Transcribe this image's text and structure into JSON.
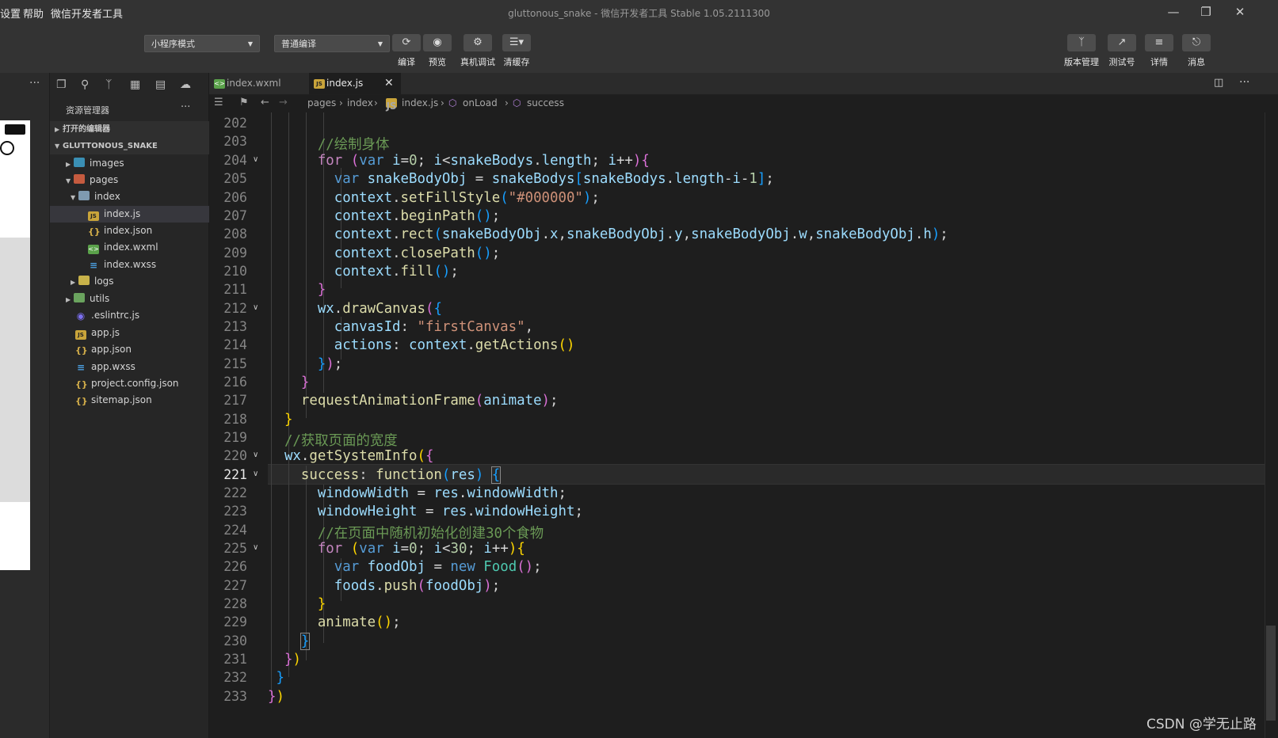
{
  "menubar": {
    "items": [
      "设置",
      "帮助",
      "微信开发者工具"
    ]
  },
  "title": "gluttonous_snake - 微信开发者工具 Stable 1.05.2111300",
  "toolbar": {
    "mode_select": "小程序模式",
    "compile_select": "普通编译",
    "buttons": [
      {
        "label": "编译",
        "icon": "refresh-icon"
      },
      {
        "label": "预览",
        "icon": "eye-icon"
      },
      {
        "label": "真机调试",
        "icon": "bug-icon"
      },
      {
        "label": "清缓存",
        "icon": "layers-icon"
      }
    ],
    "right_buttons": [
      {
        "label": "版本管理",
        "icon": "branch-icon"
      },
      {
        "label": "测试号",
        "icon": "external-link-icon"
      },
      {
        "label": "详情",
        "icon": "menu-icon"
      },
      {
        "label": "消息",
        "icon": "bell-icon"
      }
    ]
  },
  "explorer": {
    "title": "资源管理器",
    "more": "···",
    "open_editors": "打开的编辑器",
    "project": "GLUTTONOUS_SNAKE",
    "tree": [
      {
        "label": "images",
        "type": "folder-img"
      },
      {
        "label": "pages",
        "type": "folder-pages"
      },
      {
        "label": "index",
        "type": "folder-open"
      },
      {
        "label": "index.js",
        "type": "js"
      },
      {
        "label": "index.json",
        "type": "json"
      },
      {
        "label": "index.wxml",
        "type": "wxml"
      },
      {
        "label": "index.wxss",
        "type": "wxss"
      },
      {
        "label": "logs",
        "type": "folder-logs"
      },
      {
        "label": "utils",
        "type": "folder-utils"
      },
      {
        "label": ".eslintrc.js",
        "type": "eslint"
      },
      {
        "label": "app.js",
        "type": "js"
      },
      {
        "label": "app.json",
        "type": "json"
      },
      {
        "label": "app.wxss",
        "type": "wxss"
      },
      {
        "label": "project.config.json",
        "type": "json"
      },
      {
        "label": "sitemap.json",
        "type": "json"
      }
    ]
  },
  "tabs": [
    {
      "label": "index.wxml",
      "active": false
    },
    {
      "label": "index.js",
      "active": true
    }
  ],
  "breadcrumb": [
    "pages",
    "index",
    "index.js",
    "onLoad",
    "success"
  ],
  "editor": {
    "current_line": 221,
    "line_numbers": [
      "202",
      "203",
      "204",
      "205",
      "206",
      "207",
      "208",
      "209",
      "210",
      "211",
      "212",
      "213",
      "214",
      "215",
      "216",
      "217",
      "218",
      "219",
      "220",
      "221",
      "222",
      "223",
      "224",
      "225",
      "226",
      "227",
      "228",
      "229",
      "230",
      "231",
      "232",
      "233"
    ]
  },
  "watermark": "CSDN @学无止路",
  "colors": {
    "keyword": "#569cd6",
    "control": "#c586c0",
    "function": "#dcdcaa",
    "string": "#ce9178",
    "comment": "#6a9955",
    "variable": "#9cdcfe"
  }
}
